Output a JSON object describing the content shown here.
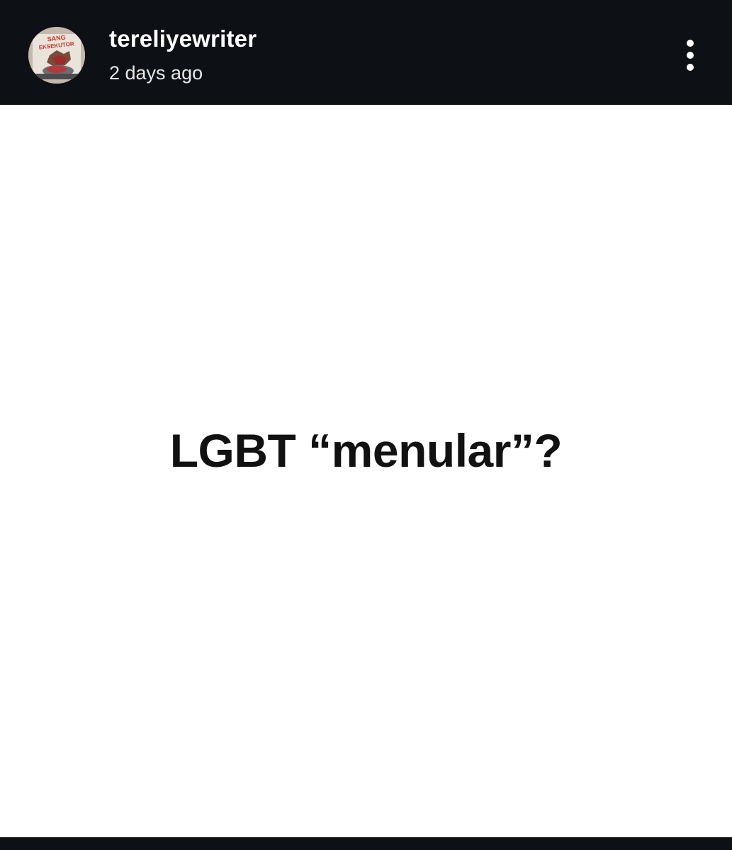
{
  "post": {
    "author": {
      "username": "tereliyewriter",
      "avatar_icon": "book-cover-avatar",
      "avatar_text": [
        "SANG",
        "EKSEKUTOR"
      ]
    },
    "timestamp": "2 days ago",
    "more_icon": "more-vertical-icon",
    "content_text": "LGBT “menular”?"
  },
  "colors": {
    "header_bg": "#0d1014",
    "post_bg": "#ffffff",
    "text_dark": "#111111",
    "text_light": "#ffffff"
  }
}
